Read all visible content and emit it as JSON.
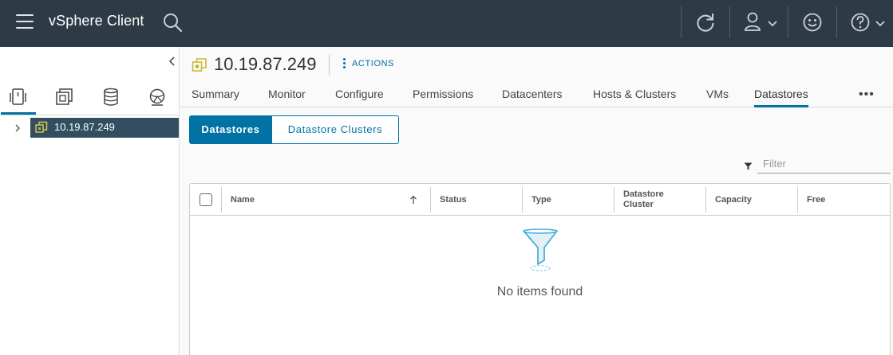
{
  "header": {
    "app_title": "vSphere Client",
    "icons": [
      "menu-icon",
      "search-icon",
      "refresh-icon",
      "user-icon",
      "chevron-down-icon",
      "feedback-smiley-icon",
      "help-icon"
    ],
    "colors": {
      "header_bg": "#2e3b47",
      "accent": "#0072a3",
      "selected_node_bg": "#324f61"
    }
  },
  "sidebar": {
    "nav_icons": [
      "hosts-and-clusters-icon",
      "vms-and-templates-icon",
      "storage-icon",
      "networking-icon"
    ],
    "tree": [
      {
        "label": "10.19.87.249",
        "expanded": false,
        "selected": true
      }
    ]
  },
  "object": {
    "title": "10.19.87.249",
    "actions_label": "ACTIONS"
  },
  "tabs": [
    {
      "label": "Summary"
    },
    {
      "label": "Monitor"
    },
    {
      "label": "Configure"
    },
    {
      "label": "Permissions"
    },
    {
      "label": "Datacenters"
    },
    {
      "label": "Hosts & Clusters"
    },
    {
      "label": "VMs"
    },
    {
      "label": "Datastores",
      "active": true
    }
  ],
  "more_label": "•••",
  "subtabs": [
    {
      "label": "Datastores",
      "active": true
    },
    {
      "label": "Datastore Clusters"
    }
  ],
  "filter": {
    "placeholder": "Filter",
    "value": ""
  },
  "grid": {
    "columns": [
      "Name",
      "Status",
      "Type",
      "Datastore Cluster",
      "Capacity",
      "Free"
    ],
    "sort_column": "Name",
    "sort_direction": "ascending",
    "rows": [],
    "empty_text": "No items found"
  }
}
